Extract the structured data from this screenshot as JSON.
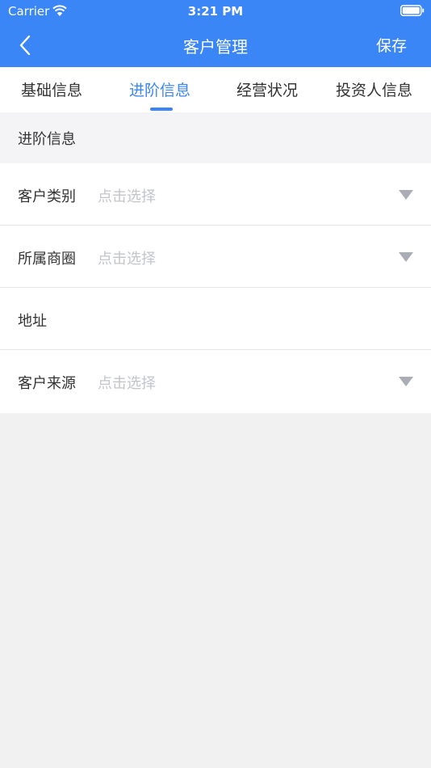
{
  "status_bar": {
    "carrier": "Carrier",
    "time": "3:21 PM"
  },
  "navbar": {
    "title": "客户管理",
    "save_label": "保存"
  },
  "tabs": [
    {
      "label": "基础信息",
      "active": false
    },
    {
      "label": "进阶信息",
      "active": true
    },
    {
      "label": "经营状况",
      "active": false
    },
    {
      "label": "投资人信息",
      "active": false
    }
  ],
  "section": {
    "title": "进阶信息"
  },
  "form": {
    "rows": [
      {
        "label": "客户类别",
        "placeholder": "点击选择",
        "dropdown": true
      },
      {
        "label": "所属商圈",
        "placeholder": "点击选择",
        "dropdown": true
      },
      {
        "label": "地址",
        "placeholder": "",
        "dropdown": false
      },
      {
        "label": "客户来源",
        "placeholder": "点击选择",
        "dropdown": true
      }
    ]
  },
  "colors": {
    "accent": "#3b86f7",
    "background": "#f1f1f1",
    "placeholder": "#c3c5cb",
    "dropdown_arrow": "#a9adb5"
  },
  "icons": {
    "wifi": "wifi-icon",
    "battery": "battery-icon",
    "back": "chevron-left-icon",
    "dropdown": "triangle-down-icon"
  }
}
